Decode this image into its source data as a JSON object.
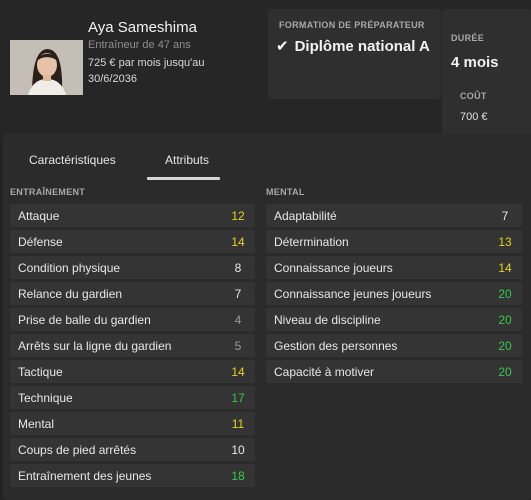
{
  "coach": {
    "name": "Aya Sameshima",
    "subtitle": "Entraîneur de 47 ans",
    "salary": "725 € par mois jusqu'au 30/6/2036"
  },
  "course": {
    "caption": "FORMATION DE PRÉPARATEUR",
    "name": "Diplôme national A"
  },
  "duration": {
    "caption": "DURÉE",
    "value": "4 mois"
  },
  "cost": {
    "caption": "COÛT",
    "value": "700 €"
  },
  "tabs": [
    {
      "label": "Caractéristiques",
      "active": false
    },
    {
      "label": "Attributs",
      "active": true
    }
  ],
  "training": {
    "caption": "ENTRAÎNEMENT",
    "rows": [
      {
        "label": "Attaque",
        "value": "12",
        "color": "yellow"
      },
      {
        "label": "Défense",
        "value": "14",
        "color": "yellow"
      },
      {
        "label": "Condition physique",
        "value": "8",
        "color": "white"
      },
      {
        "label": "Relance du gardien",
        "value": "7",
        "color": "white"
      },
      {
        "label": "Prise de balle du gardien",
        "value": "4",
        "color": "grey"
      },
      {
        "label": "Arrêts sur la ligne du gardien",
        "value": "5",
        "color": "grey"
      },
      {
        "label": "Tactique",
        "value": "14",
        "color": "yellow"
      },
      {
        "label": "Technique",
        "value": "17",
        "color": "green"
      },
      {
        "label": "Mental",
        "value": "11",
        "color": "yellow"
      },
      {
        "label": "Coups de pied arrêtés",
        "value": "10",
        "color": "white"
      },
      {
        "label": "Entraînement des jeunes",
        "value": "18",
        "color": "green"
      }
    ]
  },
  "mental": {
    "caption": "MENTAL",
    "rows": [
      {
        "label": "Adaptabilité",
        "value": "7",
        "color": "white"
      },
      {
        "label": "Détermination",
        "value": "13",
        "color": "yellow"
      },
      {
        "label": "Connaissance joueurs",
        "value": "14",
        "color": "yellow"
      },
      {
        "label": "Connaissance jeunes joueurs",
        "value": "20",
        "color": "green"
      },
      {
        "label": "Niveau de discipline",
        "value": "20",
        "color": "green"
      },
      {
        "label": "Gestion des personnes",
        "value": "20",
        "color": "green"
      },
      {
        "label": "Capacité à motiver",
        "value": "20",
        "color": "green"
      }
    ]
  },
  "colors": {
    "white": "#e8e8e8",
    "grey": "#9a9a9a",
    "yellow": "#e6d21f",
    "green": "#35c94a"
  }
}
